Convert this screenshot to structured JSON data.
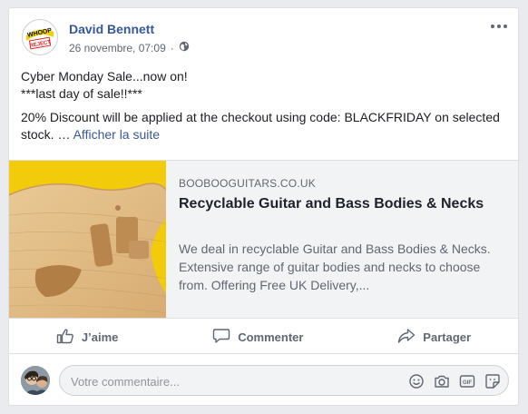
{
  "post": {
    "author": "David Bennett",
    "date": "26 novembre, 07:09",
    "separator": "·",
    "avatar_logo_text": [
      "WHOOP",
      "REJECT"
    ],
    "text_lines": [
      "Cyber Monday Sale...now on!",
      "***last day of sale!!***"
    ],
    "text_paragraph": "20% Discount will be applied at the checkout using code: BLACKFRIDAY on selected stock. …",
    "see_more": "Afficher la suite"
  },
  "link_preview": {
    "domain": "BOOBOOGUITARS.CO.UK",
    "title": "Recyclable Guitar and Bass Bodies & Necks",
    "description": "We deal in recyclable Guitar and Bass Bodies & Necks. Extensive range of guitar bodies and necks to choose from. Offering Free UK Delivery,..."
  },
  "actions": {
    "like": "J’aime",
    "comment": "Commenter",
    "share": "Partager"
  },
  "comment": {
    "placeholder": "Votre commentaire..."
  },
  "icons": {
    "privacy": "globe-icon",
    "more": "more-options-icon",
    "like": "thumbs-up-icon",
    "comment": "comment-bubble-icon",
    "share": "share-arrow-icon",
    "emoji": "emoji-icon",
    "camera": "camera-icon",
    "gif": "gif-icon",
    "sticker": "sticker-icon"
  },
  "colors": {
    "link": "#385898",
    "author": "#365899",
    "preview_bg": "#f2f3f5",
    "image_bg": "#f2cc0a"
  }
}
